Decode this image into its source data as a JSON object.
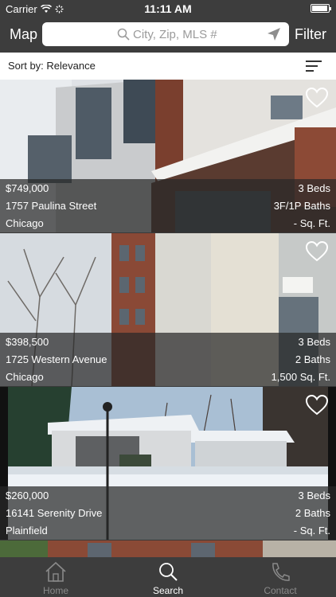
{
  "status": {
    "carrier": "Carrier",
    "time": "11:11 AM"
  },
  "nav": {
    "map_label": "Map",
    "filter_label": "Filter",
    "search_placeholder": "City, Zip, MLS #"
  },
  "sort": {
    "label": "Sort by: Relevance"
  },
  "listings": [
    {
      "price": "$749,000",
      "address": "1757 Paulina Street",
      "city": "Chicago",
      "beds": "3 Beds",
      "baths": "3F/1P Baths",
      "sqft": "- Sq. Ft."
    },
    {
      "price": "$398,500",
      "address": "1725 Western Avenue",
      "city": "Chicago",
      "beds": "3 Beds",
      "baths": "2 Baths",
      "sqft": "1,500 Sq. Ft."
    },
    {
      "price": "$260,000",
      "address": "16141 Serenity Drive",
      "city": "Plainfield",
      "beds": "3 Beds",
      "baths": "2 Baths",
      "sqft": "- Sq. Ft."
    }
  ],
  "tabs": [
    {
      "label": "Home",
      "color": "#8a8a8a"
    },
    {
      "label": "Search",
      "color": "#ffffff"
    },
    {
      "label": "Contact",
      "color": "#8a8a8a"
    }
  ]
}
